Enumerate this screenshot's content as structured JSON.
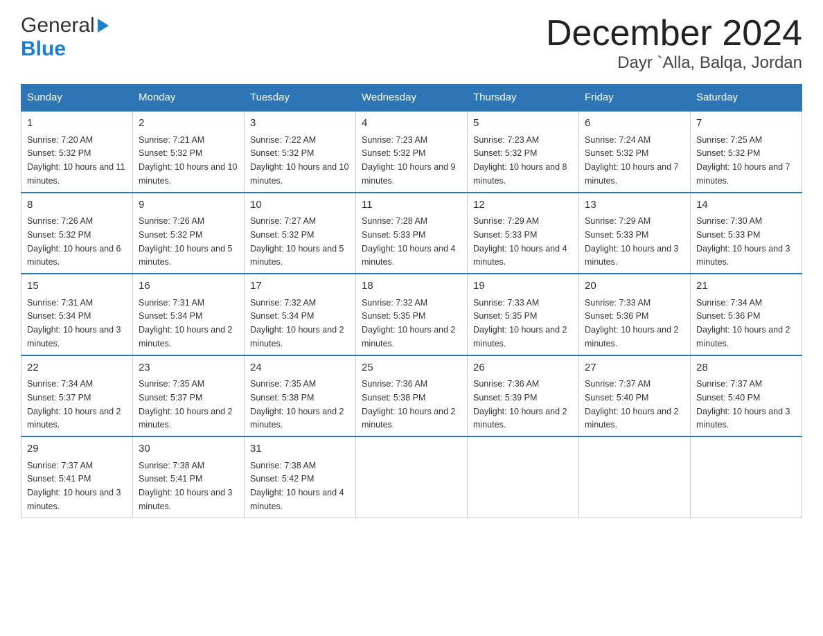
{
  "header": {
    "logo_general": "General",
    "logo_blue": "Blue",
    "month_title": "December 2024",
    "location": "Dayr `Alla, Balqa, Jordan"
  },
  "columns": [
    "Sunday",
    "Monday",
    "Tuesday",
    "Wednesday",
    "Thursday",
    "Friday",
    "Saturday"
  ],
  "weeks": [
    [
      {
        "day": "1",
        "sunrise": "7:20 AM",
        "sunset": "5:32 PM",
        "daylight": "10 hours and 11 minutes."
      },
      {
        "day": "2",
        "sunrise": "7:21 AM",
        "sunset": "5:32 PM",
        "daylight": "10 hours and 10 minutes."
      },
      {
        "day": "3",
        "sunrise": "7:22 AM",
        "sunset": "5:32 PM",
        "daylight": "10 hours and 10 minutes."
      },
      {
        "day": "4",
        "sunrise": "7:23 AM",
        "sunset": "5:32 PM",
        "daylight": "10 hours and 9 minutes."
      },
      {
        "day": "5",
        "sunrise": "7:23 AM",
        "sunset": "5:32 PM",
        "daylight": "10 hours and 8 minutes."
      },
      {
        "day": "6",
        "sunrise": "7:24 AM",
        "sunset": "5:32 PM",
        "daylight": "10 hours and 7 minutes."
      },
      {
        "day": "7",
        "sunrise": "7:25 AM",
        "sunset": "5:32 PM",
        "daylight": "10 hours and 7 minutes."
      }
    ],
    [
      {
        "day": "8",
        "sunrise": "7:26 AM",
        "sunset": "5:32 PM",
        "daylight": "10 hours and 6 minutes."
      },
      {
        "day": "9",
        "sunrise": "7:26 AM",
        "sunset": "5:32 PM",
        "daylight": "10 hours and 5 minutes."
      },
      {
        "day": "10",
        "sunrise": "7:27 AM",
        "sunset": "5:32 PM",
        "daylight": "10 hours and 5 minutes."
      },
      {
        "day": "11",
        "sunrise": "7:28 AM",
        "sunset": "5:33 PM",
        "daylight": "10 hours and 4 minutes."
      },
      {
        "day": "12",
        "sunrise": "7:29 AM",
        "sunset": "5:33 PM",
        "daylight": "10 hours and 4 minutes."
      },
      {
        "day": "13",
        "sunrise": "7:29 AM",
        "sunset": "5:33 PM",
        "daylight": "10 hours and 3 minutes."
      },
      {
        "day": "14",
        "sunrise": "7:30 AM",
        "sunset": "5:33 PM",
        "daylight": "10 hours and 3 minutes."
      }
    ],
    [
      {
        "day": "15",
        "sunrise": "7:31 AM",
        "sunset": "5:34 PM",
        "daylight": "10 hours and 3 minutes."
      },
      {
        "day": "16",
        "sunrise": "7:31 AM",
        "sunset": "5:34 PM",
        "daylight": "10 hours and 2 minutes."
      },
      {
        "day": "17",
        "sunrise": "7:32 AM",
        "sunset": "5:34 PM",
        "daylight": "10 hours and 2 minutes."
      },
      {
        "day": "18",
        "sunrise": "7:32 AM",
        "sunset": "5:35 PM",
        "daylight": "10 hours and 2 minutes."
      },
      {
        "day": "19",
        "sunrise": "7:33 AM",
        "sunset": "5:35 PM",
        "daylight": "10 hours and 2 minutes."
      },
      {
        "day": "20",
        "sunrise": "7:33 AM",
        "sunset": "5:36 PM",
        "daylight": "10 hours and 2 minutes."
      },
      {
        "day": "21",
        "sunrise": "7:34 AM",
        "sunset": "5:36 PM",
        "daylight": "10 hours and 2 minutes."
      }
    ],
    [
      {
        "day": "22",
        "sunrise": "7:34 AM",
        "sunset": "5:37 PM",
        "daylight": "10 hours and 2 minutes."
      },
      {
        "day": "23",
        "sunrise": "7:35 AM",
        "sunset": "5:37 PM",
        "daylight": "10 hours and 2 minutes."
      },
      {
        "day": "24",
        "sunrise": "7:35 AM",
        "sunset": "5:38 PM",
        "daylight": "10 hours and 2 minutes."
      },
      {
        "day": "25",
        "sunrise": "7:36 AM",
        "sunset": "5:38 PM",
        "daylight": "10 hours and 2 minutes."
      },
      {
        "day": "26",
        "sunrise": "7:36 AM",
        "sunset": "5:39 PM",
        "daylight": "10 hours and 2 minutes."
      },
      {
        "day": "27",
        "sunrise": "7:37 AM",
        "sunset": "5:40 PM",
        "daylight": "10 hours and 2 minutes."
      },
      {
        "day": "28",
        "sunrise": "7:37 AM",
        "sunset": "5:40 PM",
        "daylight": "10 hours and 3 minutes."
      }
    ],
    [
      {
        "day": "29",
        "sunrise": "7:37 AM",
        "sunset": "5:41 PM",
        "daylight": "10 hours and 3 minutes."
      },
      {
        "day": "30",
        "sunrise": "7:38 AM",
        "sunset": "5:41 PM",
        "daylight": "10 hours and 3 minutes."
      },
      {
        "day": "31",
        "sunrise": "7:38 AM",
        "sunset": "5:42 PM",
        "daylight": "10 hours and 4 minutes."
      },
      null,
      null,
      null,
      null
    ]
  ]
}
